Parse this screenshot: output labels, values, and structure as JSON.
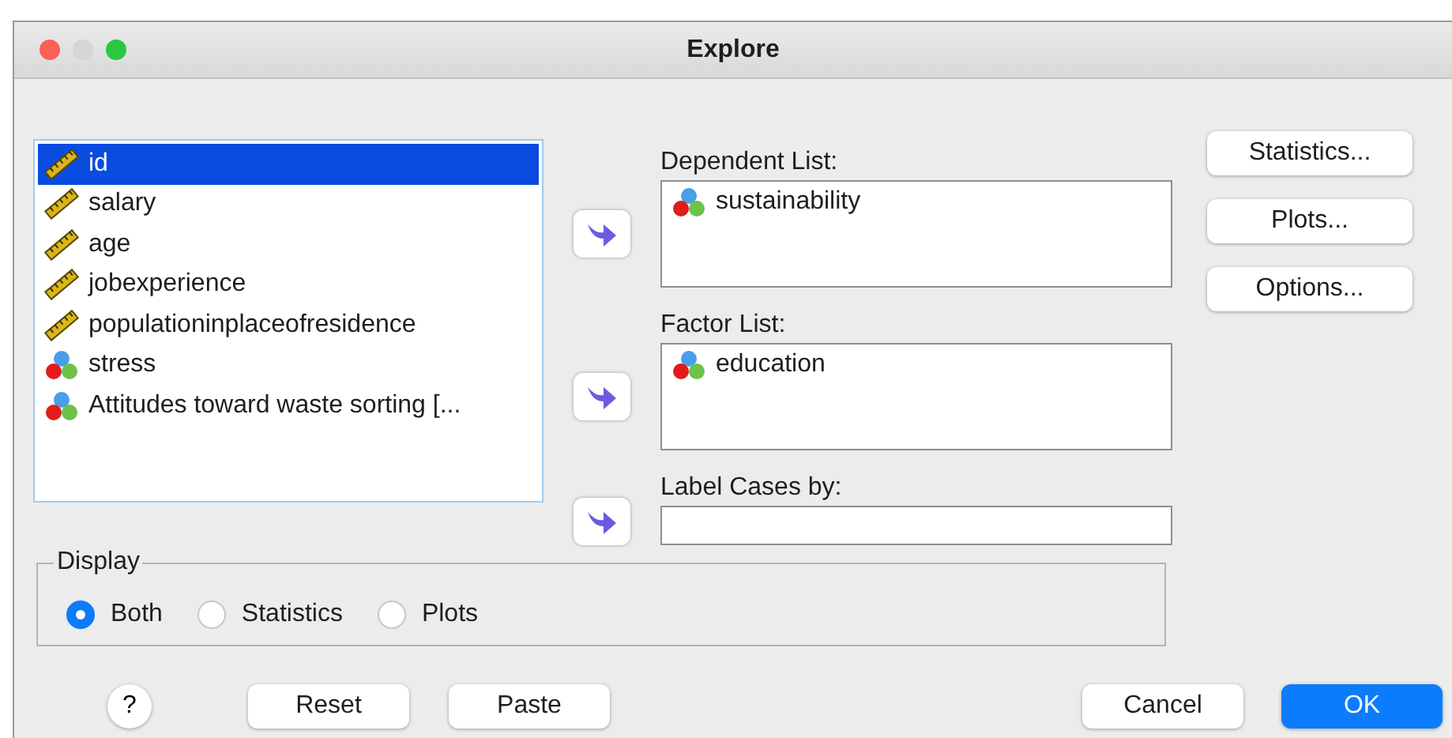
{
  "window": {
    "title": "Explore"
  },
  "source_list": {
    "items": [
      {
        "label": "id",
        "kind": "scale",
        "selected": true
      },
      {
        "label": "salary",
        "kind": "scale",
        "selected": false
      },
      {
        "label": "age",
        "kind": "scale",
        "selected": false
      },
      {
        "label": "jobexperience",
        "kind": "scale",
        "selected": false
      },
      {
        "label": "populationinplaceofresidence",
        "kind": "scale",
        "selected": false
      },
      {
        "label": "stress",
        "kind": "nominal",
        "selected": false
      },
      {
        "label": "Attitudes toward waste sorting [...",
        "kind": "nominal",
        "selected": false
      }
    ]
  },
  "target_lists": [
    {
      "label": "Dependent List:",
      "kind": "list",
      "items": [
        {
          "label": "sustainability",
          "kind": "nominal"
        }
      ]
    },
    {
      "label": "Factor List:",
      "kind": "list",
      "items": [
        {
          "label": "education",
          "kind": "nominal"
        }
      ]
    },
    {
      "label": "Label Cases by:",
      "kind": "field"
    }
  ],
  "side_buttons": [
    "Statistics...",
    "Plots...",
    "Options..."
  ],
  "display": {
    "title": "Display",
    "options": [
      {
        "label": "Both",
        "selected": true
      },
      {
        "label": "Statistics",
        "selected": false
      },
      {
        "label": "Plots",
        "selected": false
      }
    ]
  },
  "footer": {
    "help": "?",
    "left_buttons": [
      "Reset",
      "Paste"
    ],
    "right_buttons": [
      {
        "label": "Cancel",
        "default": false
      },
      {
        "label": "OK",
        "default": true
      }
    ]
  }
}
